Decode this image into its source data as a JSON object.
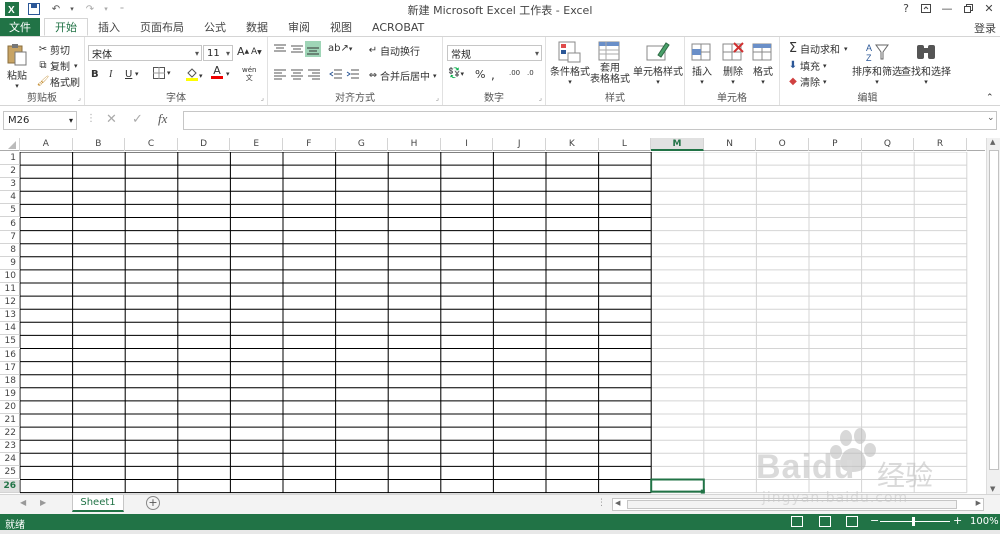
{
  "window": {
    "title": "新建 Microsoft Excel 工作表 - Excel",
    "help": "?",
    "login": "登录"
  },
  "tabs": [
    {
      "label": "文件"
    },
    {
      "label": "开始"
    },
    {
      "label": "插入"
    },
    {
      "label": "页面布局"
    },
    {
      "label": "公式"
    },
    {
      "label": "数据"
    },
    {
      "label": "审阅"
    },
    {
      "label": "视图"
    },
    {
      "label": "ACROBAT"
    }
  ],
  "ribbon": {
    "clipboard": {
      "label": "剪贴板",
      "paste": "粘贴",
      "cut": "剪切",
      "copy": "复制",
      "format_painter": "格式刷"
    },
    "font": {
      "label": "字体",
      "font_name": "宋体",
      "font_size": "11",
      "bold": "B",
      "italic": "I",
      "underline": "U",
      "grow": "A",
      "shrink": "A",
      "font_color_glyph": "A",
      "phonetic": "wén"
    },
    "alignment": {
      "label": "对齐方式",
      "wrap_text": "自动换行",
      "merge_center": "合并后居中"
    },
    "number": {
      "label": "数字",
      "format": "常规",
      "percent": "%",
      "comma": ",",
      "increase_decimal": ".00",
      "decrease_decimal": ".0"
    },
    "styles": {
      "label": "样式",
      "conditional": "条件格式",
      "table_line1": "套用",
      "table_line2": "表格格式",
      "cell_styles": "单元格样式"
    },
    "cells": {
      "label": "单元格",
      "insert": "插入",
      "delete": "删除",
      "format": "格式"
    },
    "editing": {
      "label": "编辑",
      "autosum": "自动求和",
      "fill": "填充",
      "clear": "清除",
      "sort_filter": "排序和筛选",
      "find_select": "查找和选择"
    }
  },
  "formula_bar": {
    "name_box": "M26",
    "fx": "fx",
    "value": ""
  },
  "sheet": {
    "columns": [
      "A",
      "B",
      "C",
      "D",
      "E",
      "F",
      "G",
      "H",
      "I",
      "J",
      "K",
      "L",
      "M",
      "N",
      "O",
      "P",
      "Q",
      "R"
    ],
    "rows": [
      "1",
      "2",
      "3",
      "4",
      "5",
      "6",
      "7",
      "8",
      "9",
      "10",
      "11",
      "12",
      "13",
      "14",
      "15",
      "16",
      "17",
      "18",
      "19",
      "20",
      "21",
      "22",
      "23",
      "24",
      "25",
      "26"
    ],
    "selected_column": "M",
    "selected_row": "26",
    "bordered_range": "A1:L26"
  },
  "sheet_tabs": [
    {
      "label": "Sheet1",
      "active": true
    }
  ],
  "add_sheet": "+",
  "status": {
    "ready": "就绪",
    "zoom": "100%",
    "zoom_minus": "−",
    "zoom_plus": "+"
  },
  "colors": {
    "accent": "#217346",
    "grid_border": "#000000",
    "gridline": "#d4d4d4"
  },
  "watermark": {
    "brand": "Baidu",
    "brand_cn": "经验",
    "url": "jingyan.baidu.com"
  }
}
